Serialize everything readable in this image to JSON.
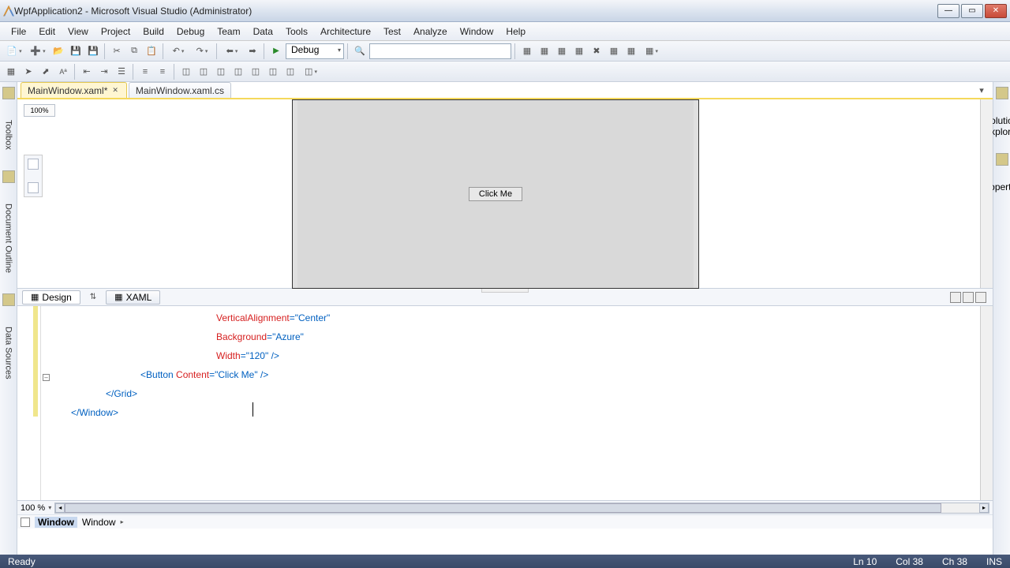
{
  "title": "WpfApplication2 - Microsoft Visual Studio (Administrator)",
  "menu": [
    "File",
    "Edit",
    "View",
    "Project",
    "Build",
    "Debug",
    "Team",
    "Data",
    "Tools",
    "Architecture",
    "Test",
    "Analyze",
    "Window",
    "Help"
  ],
  "config": "Debug",
  "left_tabs": [
    "Toolbox",
    "Document Outline",
    "Data Sources"
  ],
  "right_tabs": [
    "Solution Explorer",
    "Properties"
  ],
  "doctabs": [
    {
      "label": "MainWindow.xaml*",
      "active": true,
      "close": true
    },
    {
      "label": "MainWindow.xaml.cs",
      "active": false,
      "close": false
    }
  ],
  "designer": {
    "zoom": "100%",
    "button_text": "Click Me"
  },
  "viewtabs": {
    "design": "Design",
    "xaml": "XAML"
  },
  "code": {
    "l1_attr": "VerticalAlignment",
    "l1_val": "\"Center\"",
    "l2_attr": "Background",
    "l2_val": "\"Azure\"",
    "l3_attr": "Width",
    "l3_val": "\"120\"",
    "l3_end": " />",
    "l4": "<Button Content=\"Click Me\" />",
    "l4_pre": "<",
    "l4_ele": "Button ",
    "l4_attr": "Content",
    "l4_eq": "=",
    "l4_val": "\"Click Me\"",
    "l4_end": " />",
    "l5_pre": "</",
    "l5_ele": "Grid",
    "l5_end": ">",
    "l6_pre": "</",
    "l6_ele": "Window",
    "l6_end": ">"
  },
  "zoom_label": "100 %",
  "breadcrumb": {
    "a": "Window",
    "b": "Window"
  },
  "status": {
    "ready": "Ready",
    "ln": "Ln 10",
    "col": "Col 38",
    "ch": "Ch 38",
    "ins": "INS"
  }
}
